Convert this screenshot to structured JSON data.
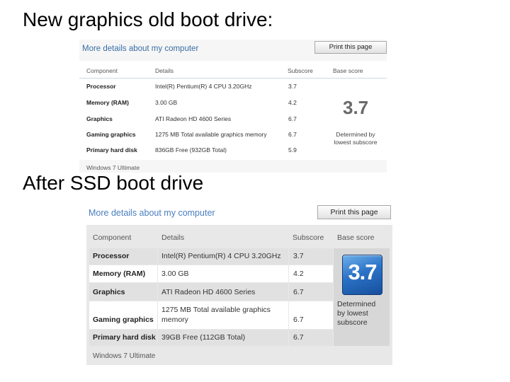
{
  "headings": {
    "before": "New graphics old boot drive:",
    "after": "After SSD boot drive"
  },
  "panel_old": {
    "title": "More details about my computer",
    "print_button": "Print this page",
    "columns": [
      "Component",
      "Details",
      "Subscore",
      "Base score"
    ],
    "rows": [
      {
        "component": "Processor",
        "details": "Intel(R) Pentium(R) 4 CPU 3.20GHz",
        "subscore": "3.7"
      },
      {
        "component": "Memory (RAM)",
        "details": "3.00 GB",
        "subscore": "4.2"
      },
      {
        "component": "Graphics",
        "details": "ATI Radeon HD 4600 Series",
        "subscore": "6.7"
      },
      {
        "component": "Gaming graphics",
        "details": "1275 MB Total available graphics memory",
        "subscore": "6.7"
      },
      {
        "component": "Primary hard disk",
        "details": "836GB Free (932GB Total)",
        "subscore": "5.9"
      }
    ],
    "base_score": "3.7",
    "base_note": "Determined by lowest subscore",
    "footer": "Windows 7 Ultimate"
  },
  "panel_new": {
    "title": "More details about my computer",
    "print_button": "Print this page",
    "columns": [
      "Component",
      "Details",
      "Subscore",
      "Base score"
    ],
    "rows": [
      {
        "component": "Processor",
        "details": "Intel(R) Pentium(R) 4 CPU 3.20GHz",
        "subscore": "3.7"
      },
      {
        "component": "Memory (RAM)",
        "details": "3.00 GB",
        "subscore": "4.2"
      },
      {
        "component": "Graphics",
        "details": "ATI Radeon HD 4600 Series",
        "subscore": "6.7"
      },
      {
        "component": "Gaming graphics",
        "details_line1": "1275 MB Total available graphics",
        "details_line2": "memory",
        "subscore": "6.7"
      },
      {
        "component": "Primary hard disk",
        "details": "39GB Free (112GB Total)",
        "subscore": "6.7"
      }
    ],
    "base_score": "3.7",
    "base_note": "Determined by lowest subscore",
    "footer": "Windows 7 Ultimate"
  },
  "colors": {
    "title_link": "#3a6ea5",
    "badge_blue": "#2b73c7",
    "panel_gray": "#e8e8e8"
  }
}
